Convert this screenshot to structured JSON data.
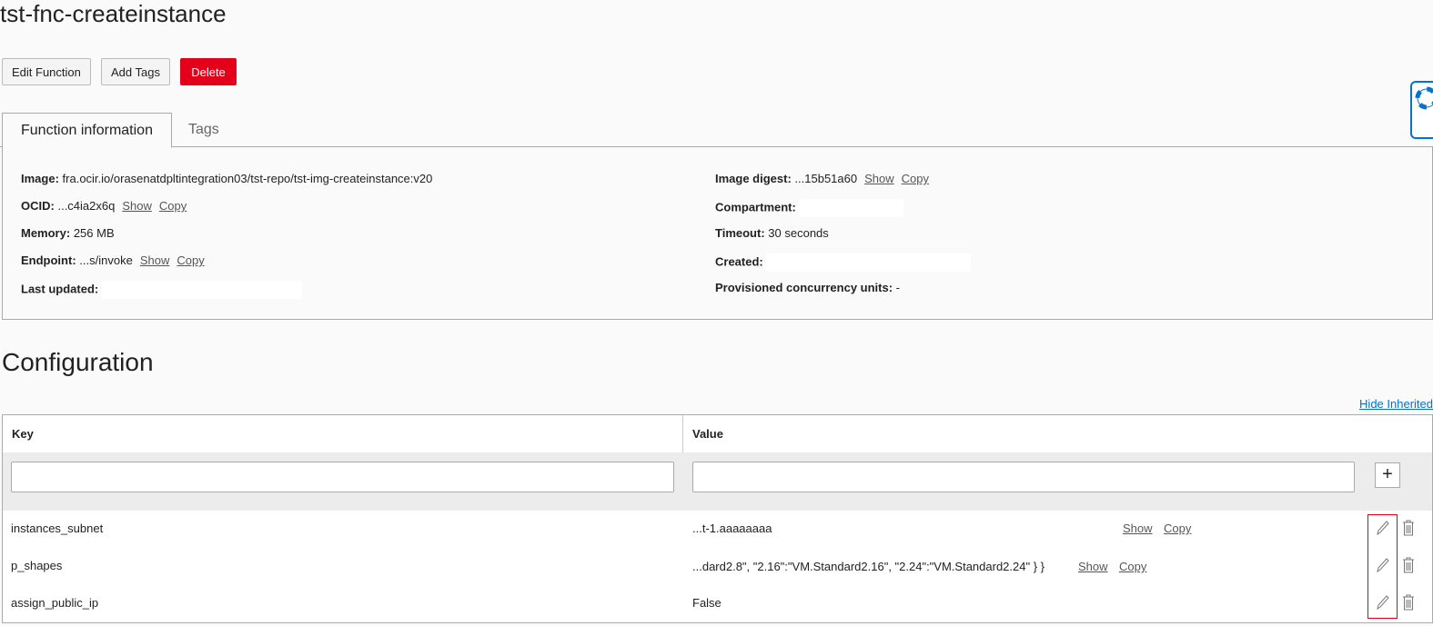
{
  "title": "tst-fnc-createinstance",
  "actions": {
    "edit": "Edit Function",
    "add_tags": "Add Tags",
    "delete": "Delete"
  },
  "tabs": [
    "Function information",
    "Tags"
  ],
  "info": {
    "image_label": "Image:",
    "image": "fra.ocir.io/orasenatdpltintegration03/tst-repo/tst-img-createinstance:v20",
    "ocid_label": "OCID:",
    "ocid": "...c4ia2x6q",
    "memory_label": "Memory:",
    "memory": "256 MB",
    "endpoint_label": "Endpoint:",
    "endpoint": "...s/invoke",
    "last_updated_label": "Last updated:",
    "digest_label": "Image digest:",
    "digest": "...15b51a60",
    "compartment_label": "Compartment:",
    "timeout_label": "Timeout:",
    "timeout": "30 seconds",
    "created_label": "Created:",
    "pcu_label": "Provisioned concurrency units:",
    "pcu": "-",
    "show": "Show",
    "copy": "Copy"
  },
  "config": {
    "heading": "Configuration",
    "hide_inherited": "Hide Inherited",
    "col_key": "Key",
    "col_value": "Value",
    "rows": [
      {
        "key": "instances_subnet",
        "value": "...t-1.aaaaaaaa"
      },
      {
        "key": "p_shapes",
        "value": "...dard2.8\", \"2.16\":\"VM.Standard2.16\", \"2.24\":\"VM.Standard2.24\" } }"
      },
      {
        "key": "assign_public_ip",
        "value": "False"
      }
    ]
  },
  "colors": {
    "accent": "#0572ce",
    "danger": "#e4001b"
  }
}
